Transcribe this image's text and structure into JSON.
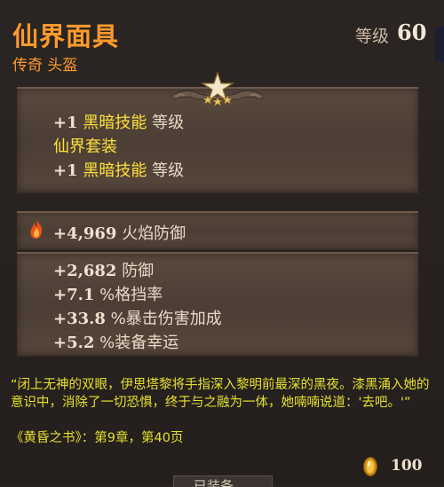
{
  "header": {
    "item_name": "仙界面具",
    "item_type": "传奇 头盔",
    "level_label": "等级",
    "level_value": "60"
  },
  "set_bonus": {
    "line1_prefix": "+1",
    "line1_skill": "黑暗技能",
    "line1_suffix": "等级",
    "set_name": "仙界套装",
    "line2_prefix": "+1",
    "line2_skill": "黑暗技能",
    "line2_suffix": "等级"
  },
  "primary_stat": {
    "icon": "fire-icon",
    "value": "+4,969",
    "label": "火焰防御"
  },
  "secondary_stats": [
    {
      "value": "+2,682",
      "label": "防御"
    },
    {
      "value": "+7.1",
      "label": "%格挡率"
    },
    {
      "value": "+33.8",
      "label": "%暴击伤害加成"
    },
    {
      "value": "+5.2",
      "label": "%装备幸运"
    }
  ],
  "lore": {
    "text": "“闭上无神的双眼，伊思塔黎将手指深入黎明前最深的黑夜。漆黑涌入她的意识中，消除了一切恐惧，终于与之融为一体，她喃喃说道：'去吧。'”",
    "source": "《黄昏之书》：第9章，第40页"
  },
  "price": {
    "icon": "gold-coin-icon",
    "value": "100"
  },
  "bottom_tab": {
    "label": "已装备"
  },
  "colors": {
    "legendary": "#ff9a2c",
    "skill": "#ffe13a",
    "lore": "#e6e02c",
    "panel": "#4f4137"
  }
}
